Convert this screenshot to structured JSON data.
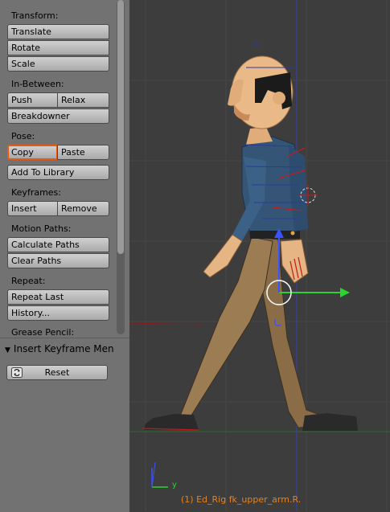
{
  "toolshelf": {
    "transform": {
      "label": "Transform:",
      "translate": "Translate",
      "rotate": "Rotate",
      "scale": "Scale"
    },
    "in_between": {
      "label": "In-Between:",
      "push": "Push",
      "relax": "Relax",
      "breakdowner": "Breakdowner"
    },
    "pose": {
      "label": "Pose:",
      "copy": "Copy",
      "paste": "Paste",
      "add_to_library": "Add To Library"
    },
    "keyframes": {
      "label": "Keyframes:",
      "insert": "Insert",
      "remove": "Remove"
    },
    "motion_paths": {
      "label": "Motion Paths:",
      "calculate": "Calculate Paths",
      "clear": "Clear Paths"
    },
    "repeat": {
      "label": "Repeat:",
      "repeat_last": "Repeat Last",
      "history": "History..."
    },
    "grease_pencil": {
      "label": "Grease Pencil:"
    }
  },
  "operator_panel": {
    "title": "Insert Keyframe Men",
    "reset": "Reset"
  },
  "viewport": {
    "object_info": "(1) Ed_Rig fk_upper_arm.R.",
    "axis_label": "y"
  },
  "colors": {
    "panel_bg": "#727272",
    "viewport_bg": "#3d3d3d",
    "active_outline": "#e35b14",
    "info_text": "#e6821e"
  }
}
